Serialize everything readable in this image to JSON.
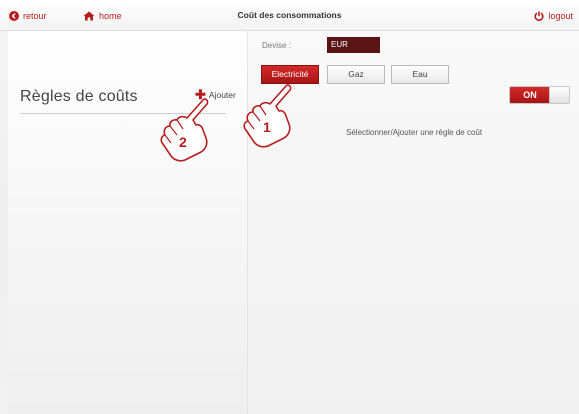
{
  "header": {
    "back_label": "retour",
    "home_label": "home",
    "title": "Coût des consommations",
    "logout_label": "logout",
    "back_icon": "back-circle-icon",
    "home_icon": "home-icon",
    "logout_icon": "power-icon"
  },
  "left_panel": {
    "title": "Règles de coûts",
    "add_label": "Ajouter",
    "add_icon": "plus-icon"
  },
  "currency": {
    "label": "Devise :",
    "value": "EUR"
  },
  "tabs": [
    {
      "label": "Electricité",
      "active": true
    },
    {
      "label": "Gaz",
      "active": false
    },
    {
      "label": "Eau",
      "active": false
    }
  ],
  "toggle": {
    "label": "ON",
    "state": true
  },
  "right_panel": {
    "hint": "Sélectionner/Ajouter une règle de coût"
  },
  "callouts": [
    {
      "number": "1",
      "icon": "pointing-hand-icon"
    },
    {
      "number": "2",
      "icon": "pointing-hand-icon"
    }
  ],
  "colors": {
    "accent": "#b71d1d",
    "active_tab": "#c41e1e",
    "currency_box": "#5a1414"
  }
}
